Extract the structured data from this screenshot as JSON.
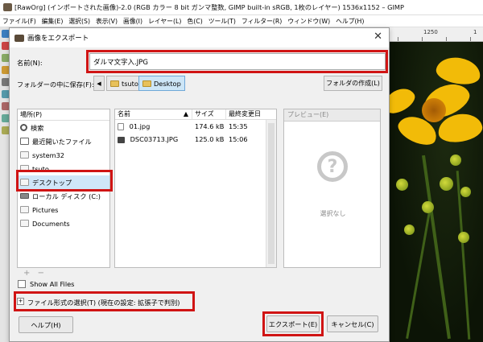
{
  "gimp": {
    "title": "[RawOrg] (インポートされた画像)-2.0 (RGB カラー 8 bit ガンマ整数, GIMP built-in sRGB, 1枚のレイヤー) 1536x1152 – GIMP",
    "menu": [
      "ファイル(F)",
      "編集(E)",
      "選択(S)",
      "表示(V)",
      "画像(I)",
      "レイヤー(L)",
      "色(C)",
      "ツール(T)",
      "フィルター(R)",
      "ウィンドウ(W)",
      "ヘルプ(H)"
    ],
    "ruler_labels": [
      "1250",
      "1"
    ]
  },
  "dialog": {
    "title": "画像をエクスポート",
    "name_label": "名前(N):",
    "name_value": "ダルマ文字入.JPG",
    "save_in_label": "フォルダーの中に保存(F):",
    "path": [
      "tsuto",
      "Desktop"
    ],
    "create_folder": "フォルダの作成(L)",
    "places_header": "場所(P)",
    "places": [
      {
        "label": "検索",
        "icon": "search-icon"
      },
      {
        "label": "最近開いたファイル",
        "icon": "recent-icon"
      },
      {
        "label": "system32",
        "icon": "folder-icon"
      },
      {
        "label": "tsuto",
        "icon": "folder-icon"
      },
      {
        "label": "デスクトップ",
        "icon": "folder-icon"
      },
      {
        "label": "ローカル ディスク (C:)",
        "icon": "drive-icon"
      },
      {
        "label": "Pictures",
        "icon": "folder-icon"
      },
      {
        "label": "Documents",
        "icon": "folder-icon"
      }
    ],
    "places_tools": [
      "+",
      "−"
    ],
    "file_columns": {
      "name": "名前",
      "size": "サイズ",
      "modified": "最終変更日"
    },
    "files": [
      {
        "name": "01.jpg",
        "size": "174.6 kB",
        "time": "15:35"
      },
      {
        "name": "DSC03713.JPG",
        "size": "125.0 kB",
        "time": "15:06"
      }
    ],
    "preview_header": "プレビュー(E)",
    "preview_empty": "選択なし",
    "show_all_files": "Show All Files",
    "file_type": "ファイル形式の選択(T) (現在の設定: 拡張子で判別)",
    "help_button": "ヘルプ(H)",
    "export_button": "エクスポート(E)",
    "cancel_button": "キャンセル(C)"
  },
  "colors": {
    "highlight": "#d01414",
    "selection": "#cfe6f8",
    "flower": "#f2bb08"
  }
}
